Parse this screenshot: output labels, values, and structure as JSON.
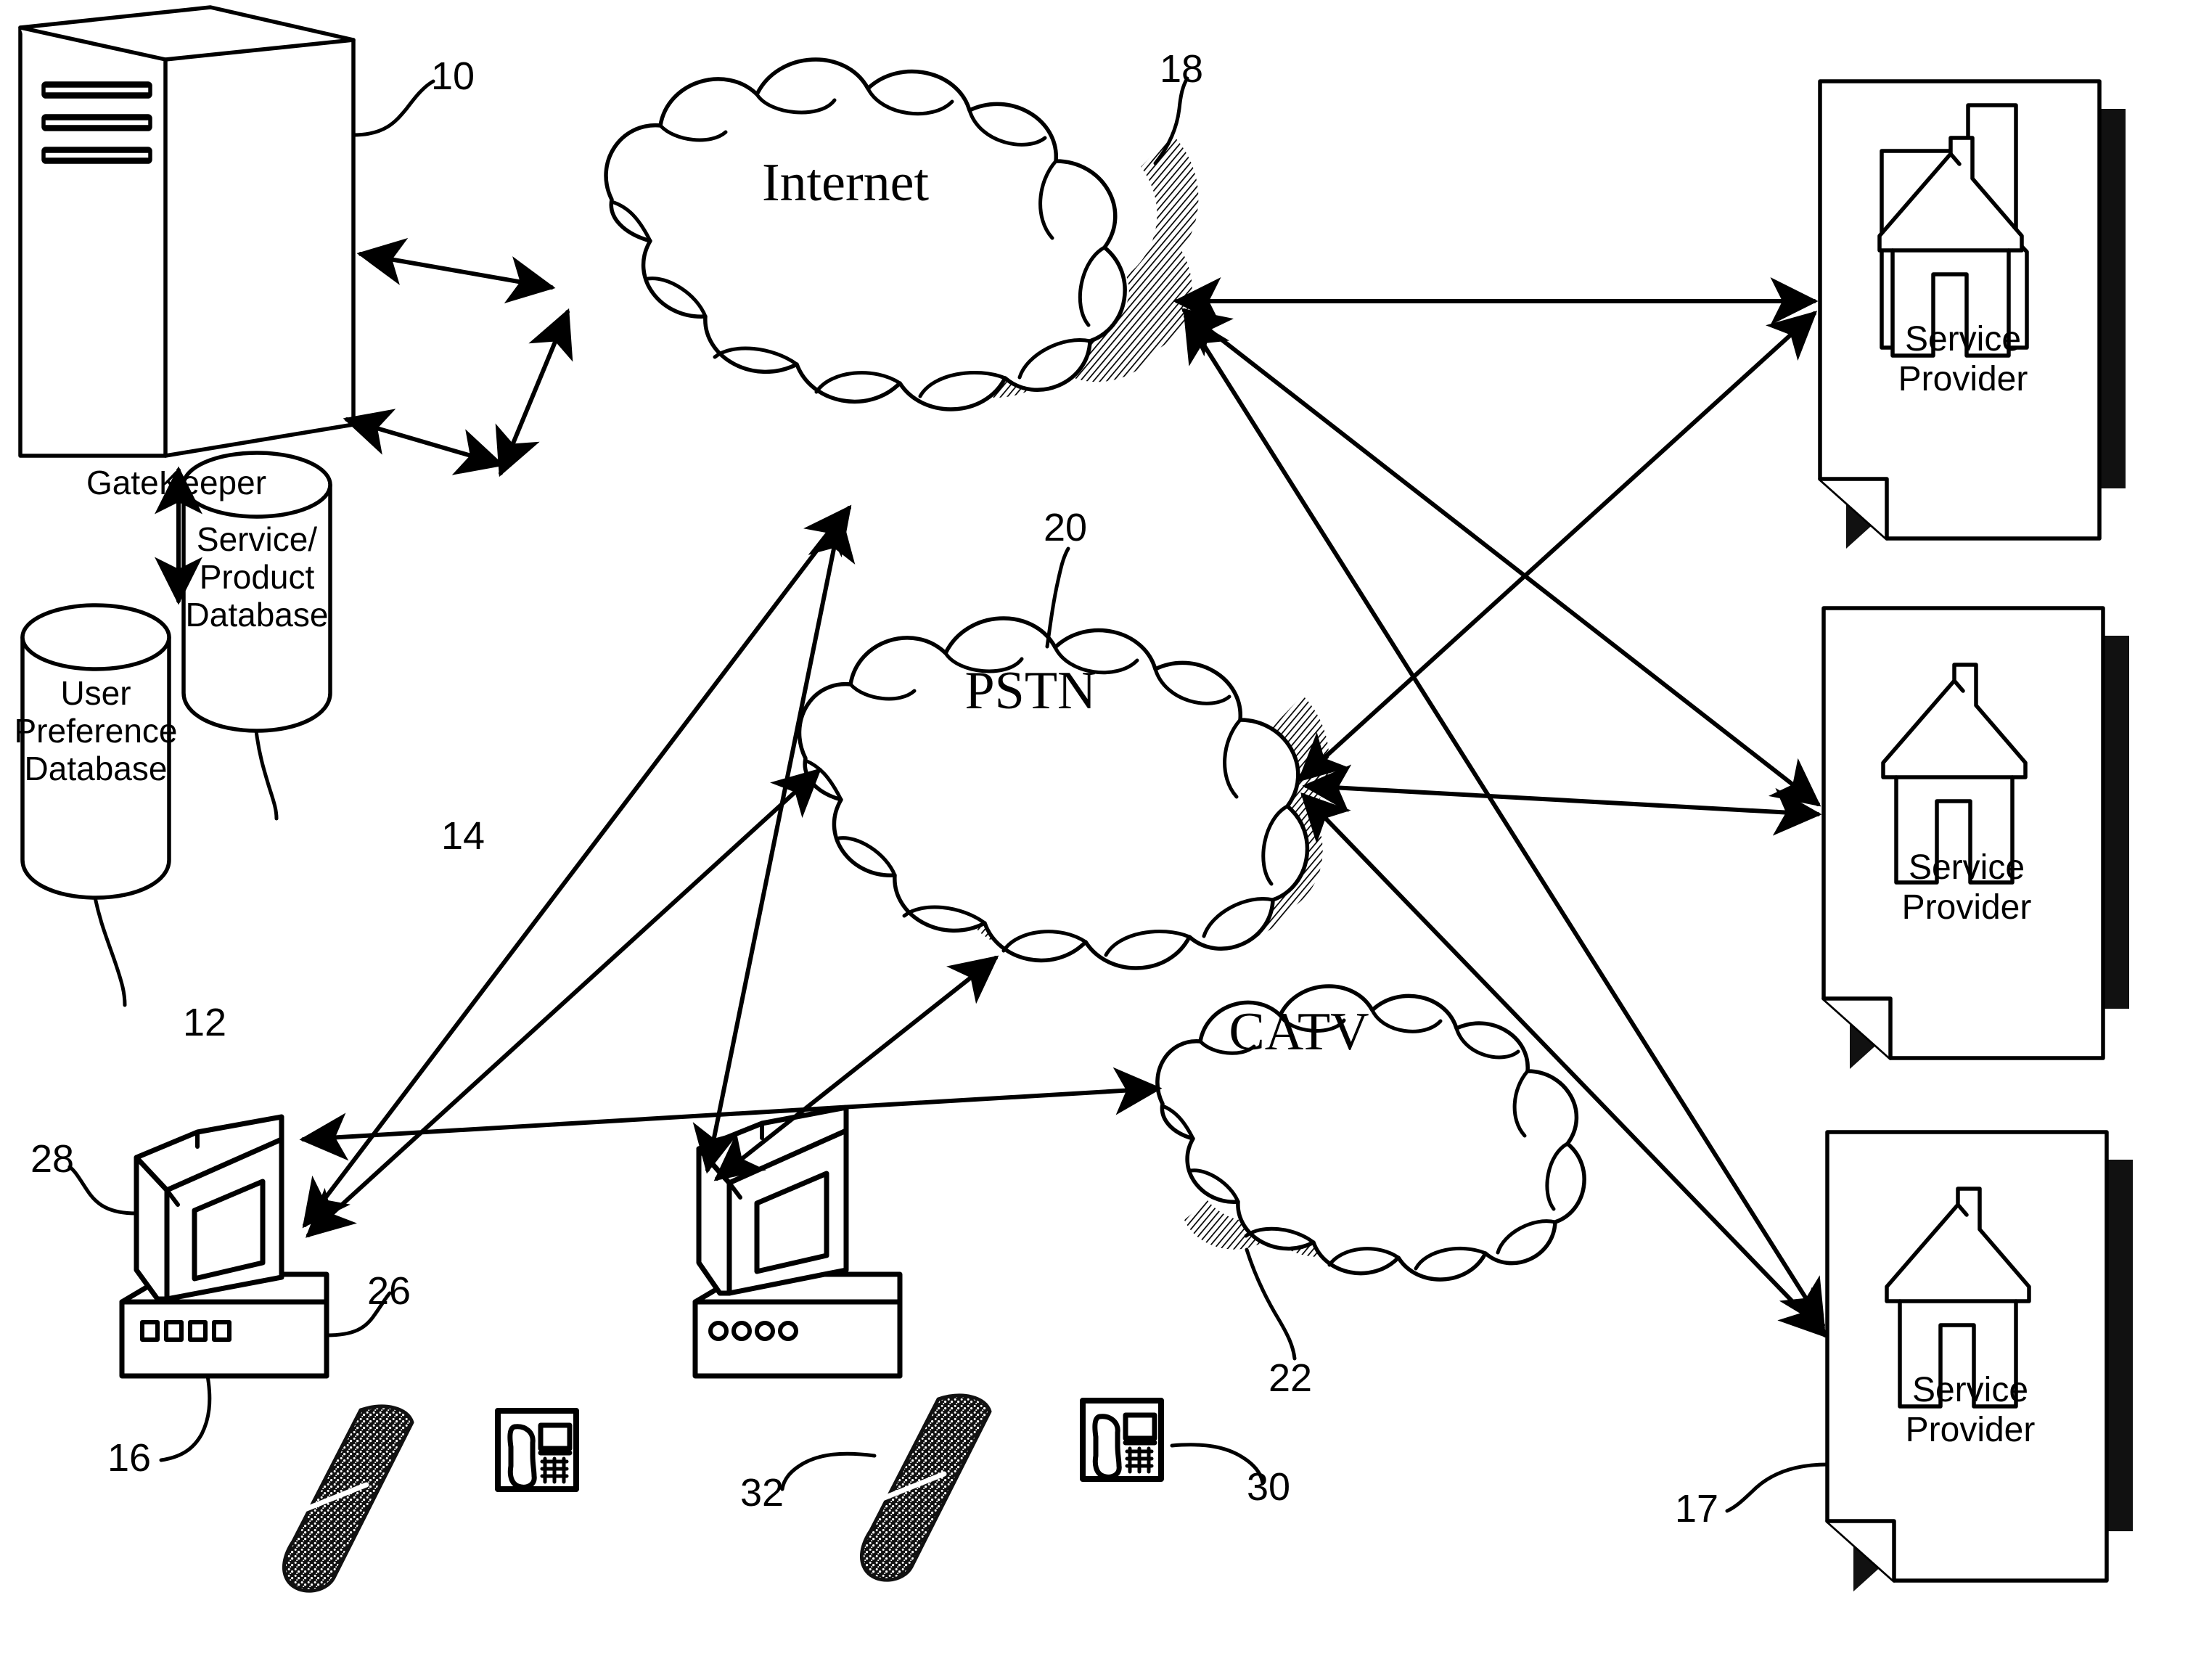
{
  "figure": {
    "type": "patent-network-diagram",
    "style": "black-and-white line art"
  },
  "nodes": {
    "gatekeeper": {
      "label": "GateKeeper",
      "ref": "10",
      "icon": "server-tower-icon"
    },
    "user_preference_db": {
      "label": "User\nPreference\nDatabase",
      "ref": "12",
      "icon": "database-cylinder-icon"
    },
    "service_product_db": {
      "label": "Service/\nProduct\nDatabase",
      "ref": "14",
      "icon": "database-cylinder-icon"
    },
    "internet_cloud": {
      "label": "Internet",
      "ref": "18",
      "icon": "cloud-icon"
    },
    "pstn_cloud": {
      "label": "PSTN",
      "ref": "20",
      "icon": "cloud-icon"
    },
    "catv_cloud": {
      "label": "CATV",
      "ref": "22",
      "icon": "cloud-icon"
    },
    "computer_left": {
      "ref": "16",
      "monitor_ref": "28",
      "base_ref": "26",
      "icon": "desktop-computer-icon"
    },
    "computer_center": {
      "icon": "desktop-computer-icon"
    },
    "remote_left": {
      "icon": "remote-control-icon"
    },
    "remote_center": {
      "ref": "32",
      "icon": "remote-control-icon"
    },
    "telephone_left": {
      "icon": "telephone-icon"
    },
    "telephone_center": {
      "ref": "30",
      "icon": "telephone-icon"
    },
    "service_provider_top": {
      "label": "Service\nProvider",
      "icon": "house-icon"
    },
    "service_provider_middle": {
      "label": "Service\nProvider",
      "icon": "house-icon"
    },
    "service_provider_bottom": {
      "label": "Service\nProvider",
      "ref": "17",
      "icon": "house-icon"
    }
  },
  "reference_numerals": [
    {
      "id": "ref-10",
      "value": "10"
    },
    {
      "id": "ref-12",
      "value": "12"
    },
    {
      "id": "ref-14",
      "value": "14"
    },
    {
      "id": "ref-16",
      "value": "16"
    },
    {
      "id": "ref-17",
      "value": "17"
    },
    {
      "id": "ref-18",
      "value": "18"
    },
    {
      "id": "ref-20",
      "value": "20"
    },
    {
      "id": "ref-22",
      "value": "22"
    },
    {
      "id": "ref-26",
      "value": "26"
    },
    {
      "id": "ref-28",
      "value": "28"
    },
    {
      "id": "ref-30",
      "value": "30"
    },
    {
      "id": "ref-32",
      "value": "32"
    }
  ],
  "connections": [
    {
      "from": "gatekeeper",
      "to": "internet_cloud",
      "style": "bidirectional"
    },
    {
      "from": "gatekeeper",
      "to": "service_product_db",
      "style": "bidirectional"
    },
    {
      "from": "gatekeeper",
      "to": "user_preference_db",
      "style": "bidirectional"
    },
    {
      "from": "service_product_db",
      "to": "internet_cloud",
      "style": "bidirectional"
    },
    {
      "from": "internet_cloud",
      "to": "service_provider_top",
      "style": "bidirectional"
    },
    {
      "from": "internet_cloud",
      "to": "service_provider_middle",
      "style": "bidirectional"
    },
    {
      "from": "internet_cloud",
      "to": "service_provider_bottom",
      "style": "bidirectional"
    },
    {
      "from": "internet_cloud",
      "to": "computer_left",
      "style": "bidirectional"
    },
    {
      "from": "internet_cloud",
      "to": "computer_center",
      "style": "bidirectional"
    },
    {
      "from": "pstn_cloud",
      "to": "service_provider_top",
      "style": "bidirectional"
    },
    {
      "from": "pstn_cloud",
      "to": "service_provider_middle",
      "style": "bidirectional"
    },
    {
      "from": "pstn_cloud",
      "to": "service_provider_bottom",
      "style": "bidirectional"
    },
    {
      "from": "pstn_cloud",
      "to": "computer_left",
      "style": "bidirectional"
    },
    {
      "from": "pstn_cloud",
      "to": "computer_center",
      "style": "bidirectional"
    },
    {
      "from": "computer_left",
      "to": "catv_cloud",
      "style": "bidirectional"
    }
  ],
  "colors": {
    "ink": "#000000",
    "paper": "#ffffff",
    "shadow": "#1a1a1a"
  }
}
